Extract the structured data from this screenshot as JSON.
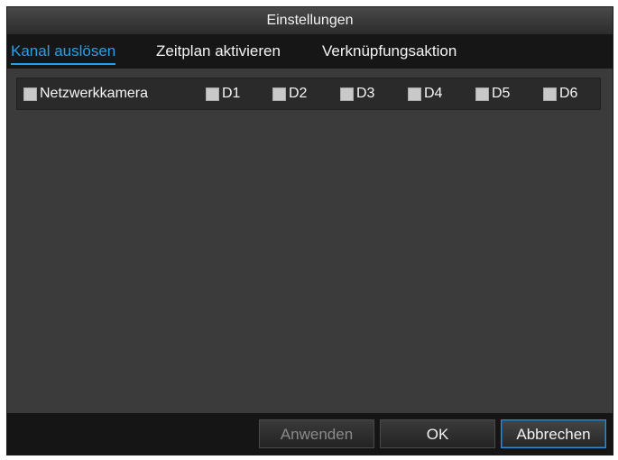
{
  "dialog": {
    "title": "Einstellungen"
  },
  "tabs": [
    {
      "label": "Kanal auslösen",
      "active": true
    },
    {
      "label": "Zeitplan aktivieren",
      "active": false
    },
    {
      "label": "Verknüpfungsaktion",
      "active": false
    }
  ],
  "channels": {
    "group_label": "Netzwerkkamera",
    "group_checked": false,
    "items": [
      {
        "label": "D1",
        "checked": false
      },
      {
        "label": "D2",
        "checked": false
      },
      {
        "label": "D3",
        "checked": false
      },
      {
        "label": "D4",
        "checked": false
      },
      {
        "label": "D5",
        "checked": false
      },
      {
        "label": "D6",
        "checked": false
      }
    ]
  },
  "buttons": {
    "apply": "Anwenden",
    "ok": "OK",
    "cancel": "Abbrechen"
  },
  "colors": {
    "accent": "#25a0e6",
    "panel": "#3b3b3b",
    "tabbar": "#161616"
  }
}
